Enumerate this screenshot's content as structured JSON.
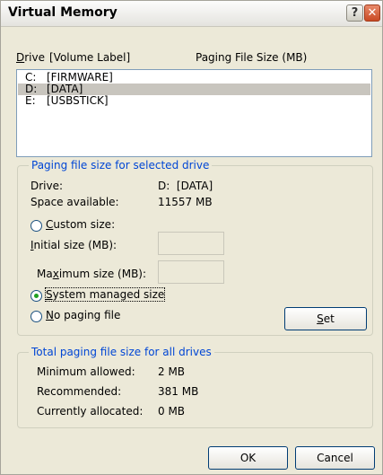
{
  "window": {
    "title": "Virtual Memory",
    "help_glyph": "?",
    "close_glyph": "✕"
  },
  "list_header": {
    "drive_prefix": "D",
    "drive_rest": "rive",
    "volume_label": "[Volume Label]",
    "paging_size": "Paging File Size (MB)"
  },
  "drives": [
    {
      "letter": "C:",
      "label": "[FIRMWARE]",
      "selected": false
    },
    {
      "letter": "D:",
      "label": "[DATA]",
      "selected": true
    },
    {
      "letter": "E:",
      "label": "[USBSTICK]",
      "selected": false
    }
  ],
  "selected_drive_group": {
    "legend": "Paging file size for selected drive",
    "drive_label": "Drive:",
    "drive_value": "D:  [DATA]",
    "space_label": "Space available:",
    "space_value": "11557 MB",
    "custom_size": {
      "mnemonic": "C",
      "rest": "ustom size:",
      "checked": false
    },
    "initial_size": {
      "mnemonic": "I",
      "rest": "nitial size (MB):",
      "value": ""
    },
    "maximum_size": {
      "before": "Ma",
      "mnemonic": "x",
      "rest": "imum size (MB):",
      "value": ""
    },
    "system_managed": {
      "mnemonic": "S",
      "rest": "ystem managed size",
      "checked": true
    },
    "no_paging": {
      "mnemonic": "N",
      "rest": "o paging file",
      "checked": false
    },
    "set_button": {
      "mnemonic": "S",
      "rest": "et"
    }
  },
  "totals_group": {
    "legend": "Total paging file size for all drives",
    "minimum_label": "Minimum allowed:",
    "minimum_value": "2 MB",
    "recommended_label": "Recommended:",
    "recommended_value": "381 MB",
    "allocated_label": "Currently allocated:",
    "allocated_value": "0 MB"
  },
  "buttons": {
    "ok": "OK",
    "cancel": "Cancel"
  }
}
